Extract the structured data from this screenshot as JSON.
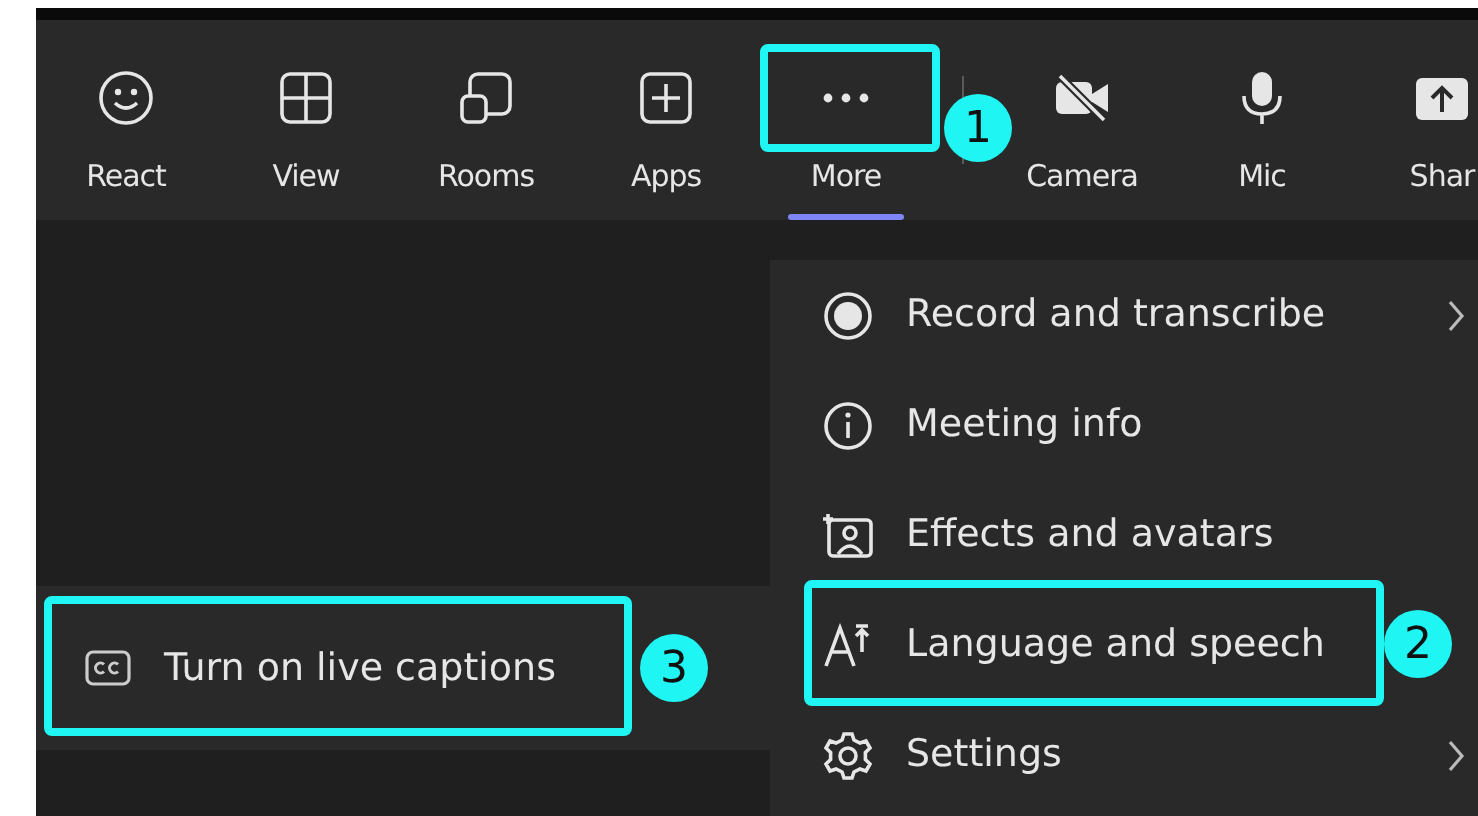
{
  "toolbar": {
    "meeting_tools": [
      {
        "label": "React",
        "selected": false
      },
      {
        "label": "View",
        "selected": false
      },
      {
        "label": "Rooms",
        "selected": false
      },
      {
        "label": "Apps",
        "selected": false
      },
      {
        "label": "More",
        "selected": true,
        "step": "1"
      }
    ],
    "device_controls": [
      {
        "label": "Camera",
        "selected": false
      },
      {
        "label": "Mic",
        "selected": false
      },
      {
        "label": "Shar",
        "selected": false
      }
    ]
  },
  "caption_popup": {
    "label": "Turn on live captions",
    "step": "3"
  },
  "more_menu": [
    {
      "label": "Record and transcribe",
      "submenu": true
    },
    {
      "label": "Meeting info",
      "submenu": false
    },
    {
      "label": "Effects and avatars",
      "submenu": false
    },
    {
      "label": "Language and speech",
      "submenu": false,
      "step": "2"
    },
    {
      "label": "Settings",
      "submenu": true
    }
  ]
}
